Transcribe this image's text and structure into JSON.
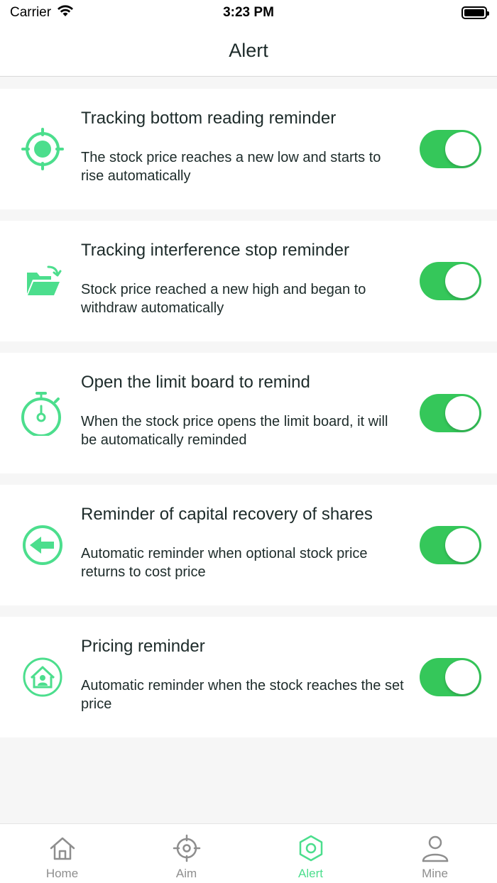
{
  "status_bar": {
    "carrier": "Carrier",
    "time": "3:23 PM"
  },
  "nav": {
    "title": "Alert"
  },
  "colors": {
    "accent": "#4cde8d",
    "toggle_on": "#35c75a",
    "tab_inactive": "#8e8e8e",
    "text": "#1d2b2a"
  },
  "alerts": [
    {
      "icon": "target-icon",
      "title": "Tracking bottom reading reminder",
      "description": "The stock price reaches a new low and starts to rise automatically",
      "enabled": true
    },
    {
      "icon": "folder-icon",
      "title": "Tracking interference stop reminder",
      "description": "Stock price reached a new high and began to withdraw automatically",
      "enabled": true
    },
    {
      "icon": "stopwatch-icon",
      "title": "Open the limit board to remind",
      "description": "When the stock price opens the limit board, it will be automatically reminded",
      "enabled": true
    },
    {
      "icon": "arrow-left-circle-icon",
      "title": "Reminder of capital recovery of shares",
      "description": "Automatic reminder when optional stock price returns to cost price",
      "enabled": true
    },
    {
      "icon": "house-user-icon",
      "title": "Pricing reminder",
      "description": "Automatic reminder when the stock reaches the set price",
      "enabled": true
    }
  ],
  "tab_bar": {
    "tabs": [
      {
        "icon": "home-icon",
        "label": "Home",
        "active": false
      },
      {
        "icon": "crosshair-icon",
        "label": "Aim",
        "active": false
      },
      {
        "icon": "hexagon-icon",
        "label": "Alert",
        "active": true
      },
      {
        "icon": "person-icon",
        "label": "Mine",
        "active": false
      }
    ]
  }
}
